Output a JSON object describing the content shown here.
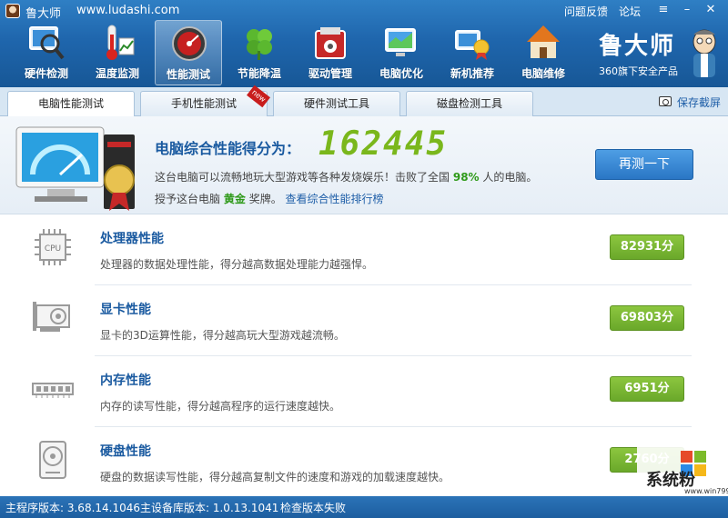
{
  "titlebar": {
    "app_name": "鲁大师",
    "url": "www.ludashi.com",
    "feedback": "问题反馈",
    "forum": "论坛"
  },
  "nav": [
    {
      "label": "硬件检测",
      "icon": "hardware-monitor-icon"
    },
    {
      "label": "温度监测",
      "icon": "thermometer-icon"
    },
    {
      "label": "性能测试",
      "icon": "speedometer-icon",
      "active": true
    },
    {
      "label": "节能降温",
      "icon": "clover-icon"
    },
    {
      "label": "驱动管理",
      "icon": "driver-box-icon"
    },
    {
      "label": "电脑优化",
      "icon": "optimize-screen-icon"
    },
    {
      "label": "新机推荐",
      "icon": "award-medal-icon"
    },
    {
      "label": "电脑维修",
      "icon": "repair-house-icon"
    }
  ],
  "brand": {
    "name": "鲁大师",
    "subtitle": "360旗下安全产品"
  },
  "tabs": [
    {
      "label": "电脑性能测试",
      "active": true
    },
    {
      "label": "手机性能测试",
      "badge": "new"
    },
    {
      "label": "硬件测试工具"
    },
    {
      "label": "磁盘检测工具"
    }
  ],
  "save_screenshot": "保存截屏",
  "score": {
    "label": "电脑综合性能得分为：",
    "value": "162445",
    "desc_prefix": "这台电脑可以流畅地玩大型游戏等各种发烧娱乐！击败了全国",
    "percent": "98%",
    "desc_suffix": "人的电脑。",
    "award_prefix": "授予这台电脑",
    "award": "黄金",
    "award_suffix": "奖牌。",
    "ranking_link": "查看综合性能排行榜",
    "retest_button": "再测一下"
  },
  "rows": [
    {
      "title": "处理器性能",
      "desc": "处理器的数据处理性能，得分越高数据处理能力越强悍。",
      "score": "82931分",
      "icon": "cpu-icon"
    },
    {
      "title": "显卡性能",
      "desc": "显卡的3D运算性能，得分越高玩大型游戏越流畅。",
      "score": "69803分",
      "icon": "graphics-card-icon"
    },
    {
      "title": "内存性能",
      "desc": "内存的读写性能，得分越高程序的运行速度越快。",
      "score": "6951分",
      "icon": "memory-stick-icon"
    },
    {
      "title": "硬盘性能",
      "desc": "硬盘的数据读写性能，得分越高复制文件的速度和游戏的加载速度越快。",
      "score": "2760分",
      "icon": "hard-disk-icon"
    }
  ],
  "status": {
    "main_version": "主程序版本: 3.68.14.1046",
    "db_version": "主设备库版本: 1.0.13.1041",
    "check": "检查版本失败"
  },
  "watermark": {
    "text": "系统粉",
    "url": "www.win7999.com"
  },
  "colors": {
    "header_blue": "#1f66ad",
    "accent_green": "#7ab71c",
    "score_badge": "#6aa82a",
    "link_blue": "#1f5fa8"
  }
}
